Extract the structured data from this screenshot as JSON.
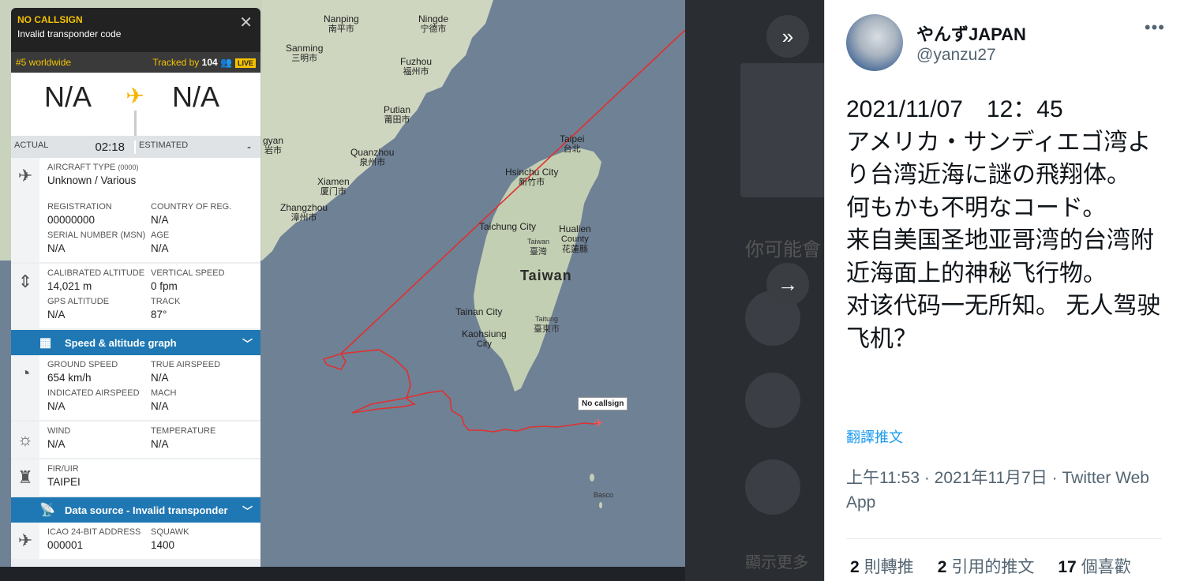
{
  "flight": {
    "callsign": "NO CALLSIGN",
    "subtitle": "Invalid transponder code",
    "rank": "#5 worldwide",
    "tracked_label": "Tracked by",
    "tracked_count": "104",
    "live": "LIVE",
    "origin": "N/A",
    "destination": "N/A",
    "actual_label": "ACTUAL",
    "actual_value": "02:18",
    "estimated_label": "ESTIMATED",
    "estimated_value": "-",
    "aircraft_type_label": "AIRCRAFT TYPE",
    "aircraft_type_code": "(0000)",
    "aircraft_type_value": "Unknown / Various",
    "registration_label": "REGISTRATION",
    "registration_value": "00000000",
    "country_label": "COUNTRY OF REG.",
    "country_value": "N/A",
    "serial_label": "SERIAL NUMBER (MSN)",
    "serial_value": "N/A",
    "age_label": "AGE",
    "age_value": "N/A",
    "cal_alt_label": "CALIBRATED ALTITUDE",
    "cal_alt_value": "14,021 m",
    "vs_label": "VERTICAL SPEED",
    "vs_value": "0 fpm",
    "gps_alt_label": "GPS ALTITUDE",
    "gps_alt_value": "N/A",
    "track_label": "TRACK",
    "track_value": "87°",
    "graph_bar": "Speed & altitude graph",
    "gs_label": "GROUND SPEED",
    "gs_value": "654 km/h",
    "tas_label": "TRUE AIRSPEED",
    "tas_value": "N/A",
    "ias_label": "INDICATED AIRSPEED",
    "ias_value": "N/A",
    "mach_label": "MACH",
    "mach_value": "N/A",
    "wind_label": "WIND",
    "wind_value": "N/A",
    "temp_label": "TEMPERATURE",
    "temp_value": "N/A",
    "fir_label": "FIR/UIR",
    "fir_value": "TAIPEI",
    "source_bar": "Data source - Invalid transponder",
    "icao_label": "ICAO 24-BIT ADDRESS",
    "icao_value": "000001",
    "squawk_label": "SQUAWK",
    "squawk_value": "1400"
  },
  "map": {
    "nanping_en": "Nanping",
    "nanping_zh": "南平市",
    "ningde_en": "Ningde",
    "ningde_zh": "宁德市",
    "sanming_en": "Sanming",
    "sanming_zh": "三明市",
    "fuzhou_en": "Fuzhou",
    "fuzhou_zh": "福州市",
    "putian_en": "Putian",
    "putian_zh": "莆田市",
    "quanzhou_en": "Quanzhou",
    "quanzhou_zh": "泉州市",
    "xiamen_en": "Xiamen",
    "xiamen_zh": "厦门市",
    "zhangzhou_en": "Zhangzhou",
    "zhangzhou_zh": "漳州市",
    "longyan_partial_en": "gyan",
    "longyan_partial_zh": "岩市",
    "taipei_en": "Taipei",
    "taipei_zh": "台北",
    "hsinchu_en": "Hsinchu City",
    "hsinchu_zh": "新竹市",
    "taichung_en": "Taichung City",
    "taiwan_small_en": "Taiwan",
    "taiwan_small_zh": "臺灣",
    "hualien_en": "Hualien",
    "hualien_en2": "County",
    "hualien_zh": "花蓮縣",
    "taiwan_big": "Taiwan",
    "tainan_en": "Tainan City",
    "taitung_en": "Taitung",
    "taitung_zh": "臺東市",
    "kaohsiung_en": "Kaohsiung",
    "kaohsiung_en2": "City",
    "basco": "Basco",
    "callsign_tag": "No callsign"
  },
  "strip": {
    "partial_text": "你可能會",
    "show_more": "顯示更多"
  },
  "tweet": {
    "name": "やんずJAPAN",
    "handle": "@yanzu27",
    "more": "•••",
    "text": "2021/11/07　12：45\nアメリカ・サンディエゴ湾より台湾近海に謎の飛翔体。\n何もかも不明なコード。\n来自美国圣地亚哥湾的台湾附近海面上的神秘飞行物。\n对该代码一无所知。 无人驾驶飞机？",
    "translate": "翻譯推文",
    "meta": "上午11:53 · 2021年11月7日 · Twitter Web App",
    "retweets_count": "2",
    "retweets_label": "則轉推",
    "quotes_count": "2",
    "quotes_label": "引用的推文",
    "likes_count": "17",
    "likes_label": "個喜歡"
  }
}
